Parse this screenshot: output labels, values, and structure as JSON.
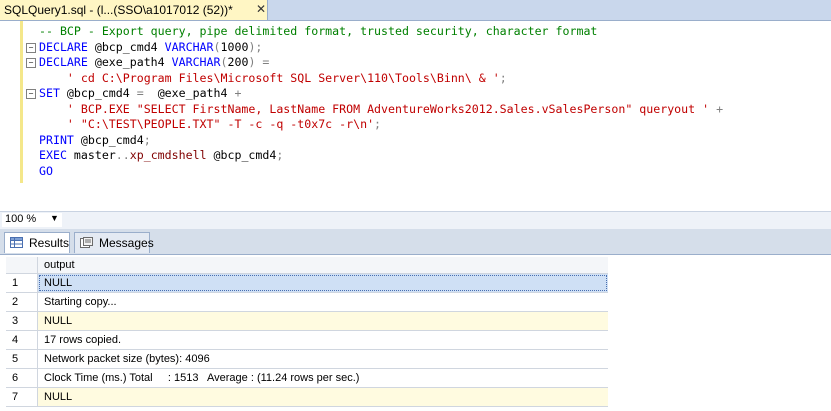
{
  "tab": {
    "title": "SQLQuery1.sql - (l...(SSO\\a1017012 (52))*",
    "close_glyph": "✕"
  },
  "editor": {
    "lines": [
      {
        "fold": "",
        "parts": [
          {
            "c": "cm",
            "t": "-- BCP - Export query, pipe delimited format, trusted security, character format"
          }
        ]
      },
      {
        "fold": "−",
        "parts": [
          {
            "c": "kw",
            "t": "DECLARE "
          },
          {
            "c": "var",
            "t": "@bcp_cmd4 "
          },
          {
            "c": "kw",
            "t": "VARCHAR"
          },
          {
            "c": "gray",
            "t": "("
          },
          {
            "c": "var",
            "t": "1000"
          },
          {
            "c": "gray",
            "t": ");"
          }
        ]
      },
      {
        "fold": "−",
        "parts": [
          {
            "c": "kw",
            "t": "DECLARE "
          },
          {
            "c": "var",
            "t": "@exe_path4 "
          },
          {
            "c": "kw",
            "t": "VARCHAR"
          },
          {
            "c": "gray",
            "t": "("
          },
          {
            "c": "var",
            "t": "200"
          },
          {
            "c": "gray",
            "t": ") ="
          }
        ]
      },
      {
        "fold": "",
        "parts": [
          {
            "c": "var",
            "t": "    "
          },
          {
            "c": "str",
            "t": "' cd C:\\Program Files\\Microsoft SQL Server\\110\\Tools\\Binn\\ & '"
          },
          {
            "c": "gray",
            "t": ";"
          }
        ]
      },
      {
        "fold": "−",
        "parts": [
          {
            "c": "kw",
            "t": "SET "
          },
          {
            "c": "var",
            "t": "@bcp_cmd4 "
          },
          {
            "c": "gray",
            "t": "=  "
          },
          {
            "c": "var",
            "t": "@exe_path4 "
          },
          {
            "c": "gray",
            "t": "+"
          }
        ]
      },
      {
        "fold": "",
        "parts": [
          {
            "c": "var",
            "t": "    "
          },
          {
            "c": "str",
            "t": "' BCP.EXE \"SELECT FirstName, LastName FROM AdventureWorks2012.Sales.vSalesPerson\" queryout '"
          },
          {
            "c": "gray",
            "t": " +"
          }
        ]
      },
      {
        "fold": "",
        "parts": [
          {
            "c": "var",
            "t": "    "
          },
          {
            "c": "str",
            "t": "' \"C:\\TEST\\PEOPLE.TXT\" -T -c -q -t0x7c -r\\n'"
          },
          {
            "c": "gray",
            "t": ";"
          }
        ]
      },
      {
        "fold": "",
        "parts": [
          {
            "c": "kw",
            "t": "PRINT "
          },
          {
            "c": "var",
            "t": "@bcp_cmd4"
          },
          {
            "c": "gray",
            "t": ";"
          }
        ]
      },
      {
        "fold": "",
        "parts": [
          {
            "c": "kw",
            "t": "EXEC "
          },
          {
            "c": "var",
            "t": "master"
          },
          {
            "c": "gray",
            "t": ".."
          },
          {
            "c": "sys",
            "t": "xp_cmdshell "
          },
          {
            "c": "var",
            "t": "@bcp_cmd4"
          },
          {
            "c": "gray",
            "t": ";"
          }
        ]
      },
      {
        "fold": "",
        "parts": [
          {
            "c": "kw",
            "t": "GO"
          }
        ]
      }
    ]
  },
  "zoom": {
    "value": "100 %",
    "arrow": "▼"
  },
  "results_tabs": [
    {
      "label": "Results",
      "icon": "results-grid-icon"
    },
    {
      "label": "Messages",
      "icon": "messages-icon"
    }
  ],
  "grid": {
    "header": "output",
    "rows": [
      {
        "num": "1",
        "value": "NULL",
        "null": true
      },
      {
        "num": "2",
        "value": "Starting copy...",
        "null": false
      },
      {
        "num": "3",
        "value": "NULL",
        "null": true
      },
      {
        "num": "4",
        "value": "17 rows copied.",
        "null": false
      },
      {
        "num": "5",
        "value": "Network packet size (bytes): 4096",
        "null": false
      },
      {
        "num": "6",
        "value": "Clock Time (ms.) Total     : 1513   Average : (11.24 rows per sec.)",
        "null": false
      },
      {
        "num": "7",
        "value": "NULL",
        "null": true
      }
    ]
  },
  "colors": {
    "keyword": "#0000ff",
    "string": "#c00000",
    "comment": "#008000",
    "system_proc": "#800000",
    "tab_active": "#fff6c4",
    "null_cell": "#fffbe0"
  }
}
